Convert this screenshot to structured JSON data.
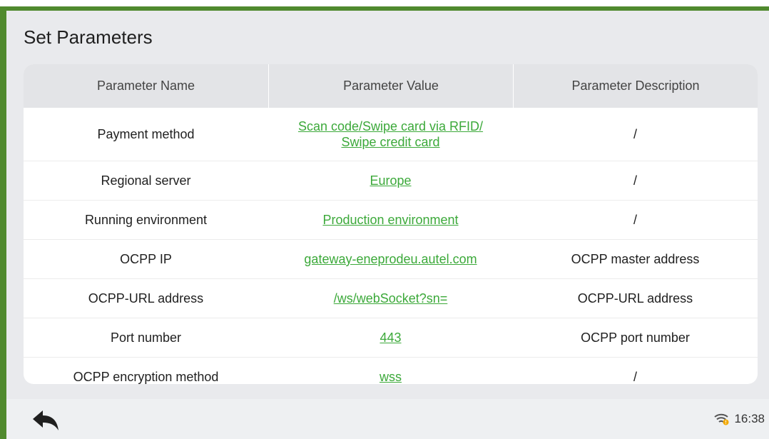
{
  "page": {
    "title": "Set Parameters"
  },
  "table": {
    "headers": [
      "Parameter Name",
      "Parameter Value",
      "Parameter Description"
    ],
    "rows": [
      {
        "name": "Payment method",
        "value": "Scan code/Swipe card via RFID/\nSwipe credit card",
        "desc": "/"
      },
      {
        "name": "Regional server",
        "value": "Europe",
        "desc": "/"
      },
      {
        "name": "Running environment",
        "value": "Production environment",
        "desc": "/"
      },
      {
        "name": "OCPP IP",
        "value": "gateway-eneprodeu.autel.com",
        "desc": "OCPP master address"
      },
      {
        "name": "OCPP-URL address",
        "value": "/ws/webSocket?sn=",
        "desc": "OCPP-URL address"
      },
      {
        "name": "Port number",
        "value": "443",
        "desc": "OCPP port number"
      },
      {
        "name": "OCPP encryption method",
        "value": "wss",
        "desc": "/"
      }
    ]
  },
  "status_bar": {
    "time": "16:38",
    "wifi_icon": "wifi-warning-icon"
  },
  "bottom_bar": {
    "back_icon": "back-arrow-icon"
  },
  "colors": {
    "frame": "#508a2e",
    "link": "#3ca93a",
    "background": "#e9eaed"
  }
}
